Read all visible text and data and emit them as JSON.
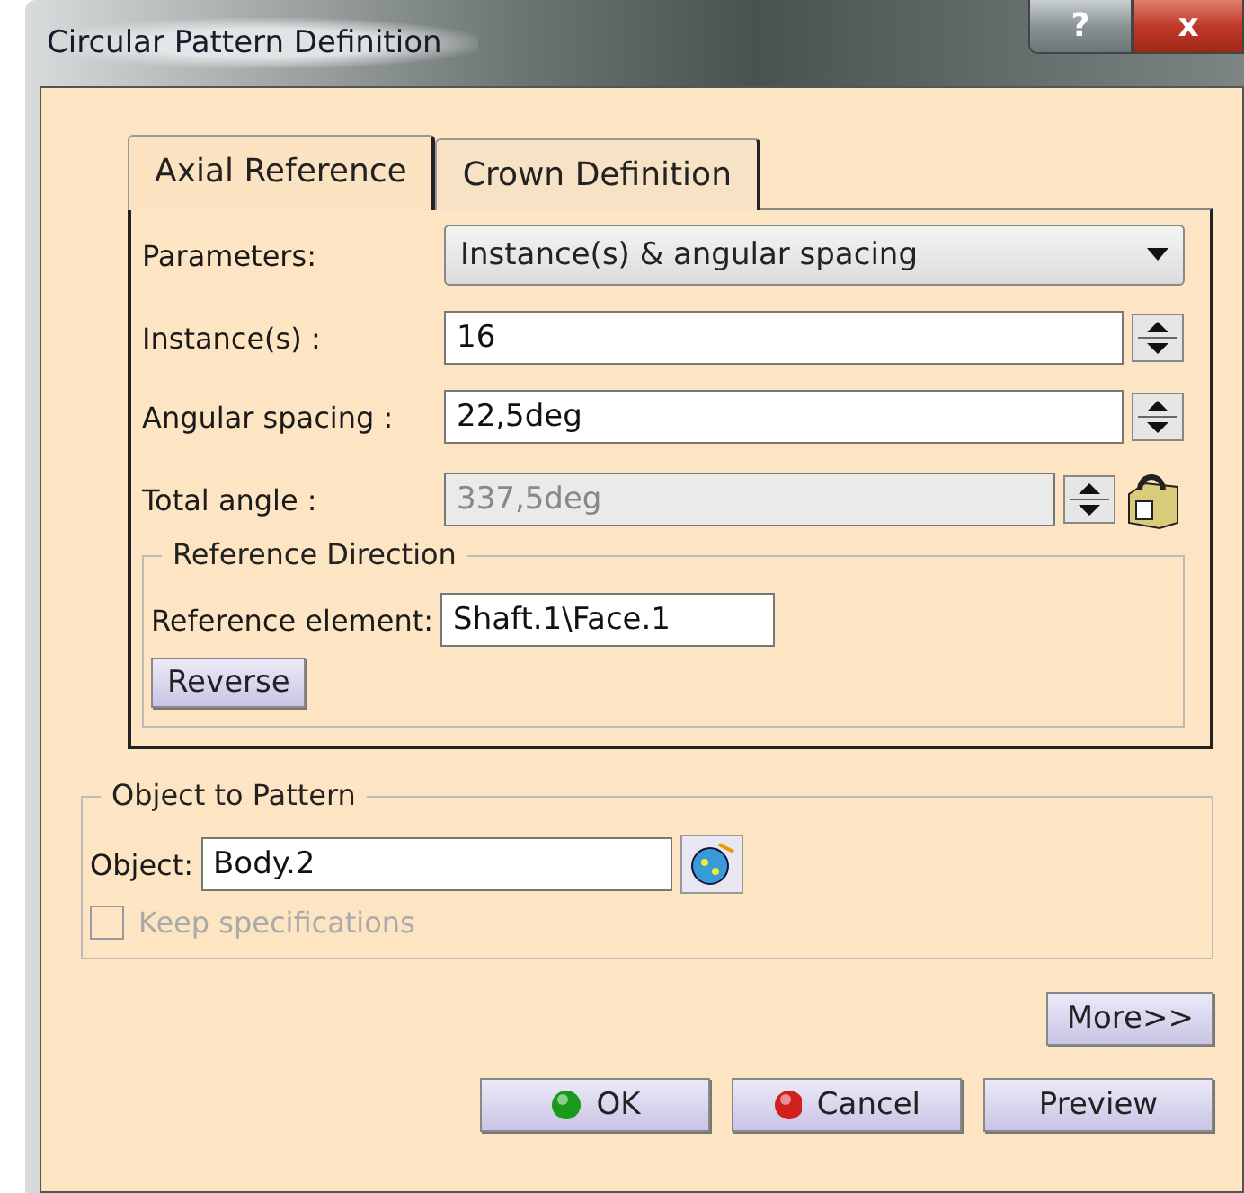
{
  "window": {
    "title": "Circular Pattern Definition",
    "help_button": "?",
    "close_button": "x"
  },
  "tabs": [
    {
      "label": "Axial Reference",
      "selected": true
    },
    {
      "label": "Crown Definition",
      "selected": false
    }
  ],
  "parameters": {
    "label": "Parameters:",
    "value": "Instance(s) & angular spacing"
  },
  "fields": [
    {
      "label": "Instance(s) :",
      "value": "16",
      "disabled": false,
      "locked": false
    },
    {
      "label": "Angular spacing :",
      "value": "22,5deg",
      "disabled": false,
      "locked": false
    },
    {
      "label": "Total angle :",
      "value": "337,5deg",
      "disabled": true,
      "locked": true
    }
  ],
  "reference_direction": {
    "title": "Reference Direction",
    "label": "Reference element:",
    "value": "Shaft.1\\Face.1",
    "button": "Reverse"
  },
  "object_to_pattern": {
    "title": "Object to Pattern",
    "label": "Object:",
    "value": "Body.2",
    "checkbox": {
      "label": "Keep specifications",
      "checked": false,
      "disabled": true
    }
  },
  "more_button": "More>>",
  "buttons": [
    {
      "label": "OK",
      "kind": "ok"
    },
    {
      "label": "Cancel",
      "kind": "cancel"
    },
    {
      "label": "Preview",
      "kind": "plain"
    }
  ]
}
